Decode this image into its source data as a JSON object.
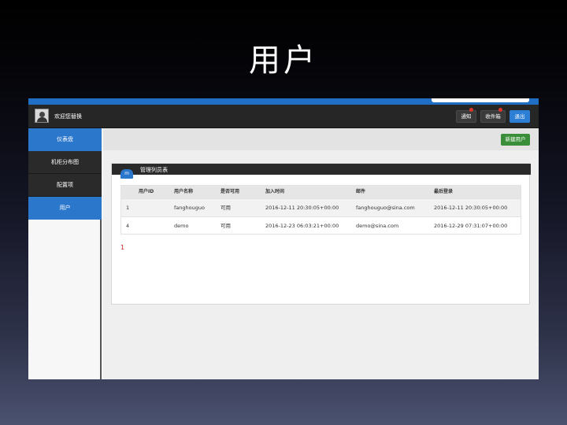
{
  "slide": {
    "title": "用户"
  },
  "navbar": {
    "welcome": "欢迎您替换",
    "notify_label": "通知",
    "inbox_label": "收件箱",
    "logout_label": "退出"
  },
  "sidebar": {
    "items": [
      {
        "label": "仪表盘",
        "state": "active"
      },
      {
        "label": "机柜分布图",
        "state": "normal"
      },
      {
        "label": "配置项",
        "state": "normal"
      },
      {
        "label": "用户",
        "state": "active"
      }
    ]
  },
  "toolbar": {
    "new_user_label": "新建用户"
  },
  "panel": {
    "icon_glyph": "m",
    "title": "管理列员表"
  },
  "table": {
    "columns": [
      "用户ID",
      "用户名称",
      "是否可用",
      "加入时间",
      "邮件",
      "最后登录"
    ],
    "rows": [
      {
        "id": "1",
        "name": "fanghouguo",
        "status": "可用",
        "joined": "2016-12-11 20:30:05+00:00",
        "email": "fanghouguo@sina.com",
        "last_login": "2016-12-11 20:30:05+00:00"
      },
      {
        "id": "4",
        "name": "demo",
        "status": "可用",
        "joined": "2016-12-23 06:03:21+00:00",
        "email": "demo@sina.com",
        "last_login": "2016-12-29 07:31:07+00:00"
      }
    ]
  },
  "pagination": {
    "current_page": "1"
  },
  "colors": {
    "primary": "#2b77cc",
    "success": "#3a8e3a",
    "navbar": "#262626",
    "danger": "#cc2222"
  },
  "icons": {
    "avatar": "user-avatar-icon",
    "notification_flag": "red-dot-icon",
    "panel": "list-icon"
  }
}
